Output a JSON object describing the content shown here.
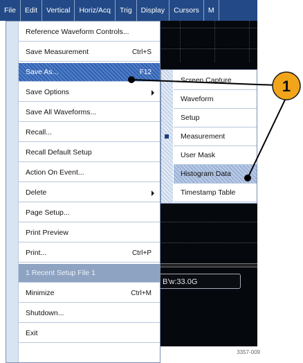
{
  "menubar": {
    "items": [
      "File",
      "Edit",
      "Vertical",
      "Horiz/Acq",
      "Trig",
      "Display",
      "Cursors",
      "M"
    ]
  },
  "file_menu": {
    "items": [
      {
        "label": "Reference Waveform Controls...",
        "shortcut": "",
        "submenu": false
      },
      {
        "label": "Save Measurement",
        "shortcut": "Ctrl+S",
        "submenu": false
      },
      {
        "label": "Save As...",
        "shortcut": "F12",
        "submenu": false
      },
      {
        "label": "Save Options",
        "shortcut": "",
        "submenu": true
      },
      {
        "label": "Save All Waveforms...",
        "shortcut": "",
        "submenu": false
      },
      {
        "label": "Recall...",
        "shortcut": "",
        "submenu": false
      },
      {
        "label": "Recall Default Setup",
        "shortcut": "",
        "submenu": false
      },
      {
        "label": "Action On Event...",
        "shortcut": "",
        "submenu": false
      },
      {
        "label": "Delete",
        "shortcut": "",
        "submenu": true
      },
      {
        "label": "Page Setup...",
        "shortcut": "",
        "submenu": false
      },
      {
        "label": "Print Preview",
        "shortcut": "",
        "submenu": false
      },
      {
        "label": "Print...",
        "shortcut": "Ctrl+P",
        "submenu": false
      },
      {
        "label": "1 Recent Setup File 1",
        "shortcut": "",
        "submenu": false
      },
      {
        "label": "Minimize",
        "shortcut": "Ctrl+M",
        "submenu": false
      },
      {
        "label": "Shutdown...",
        "shortcut": "",
        "submenu": false
      },
      {
        "label": "Exit",
        "shortcut": "",
        "submenu": false
      }
    ]
  },
  "save_as_submenu": {
    "items": [
      "Screen Capture",
      "Waveform",
      "Setup",
      "Measurement",
      "User Mask",
      "Histogram Data",
      "Timestamp Table"
    ]
  },
  "scope": {
    "readout": "B'w:33.0G"
  },
  "callout": {
    "number": "1"
  },
  "figure_id": "3357-009",
  "colors": {
    "menubar": "#234a86",
    "highlight": "#2f62b5",
    "callout_fill": "#f2a51a"
  }
}
